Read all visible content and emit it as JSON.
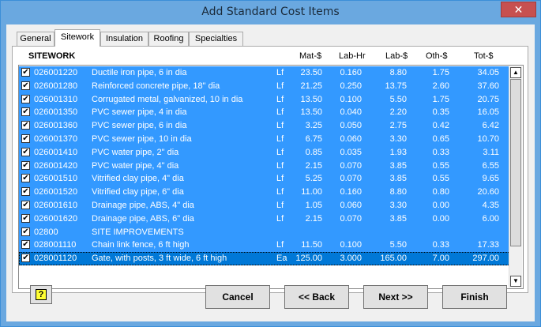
{
  "window": {
    "title": "Add Standard Cost Items",
    "close_glyph": "✕"
  },
  "tabs": [
    "General",
    "Sitework",
    "Insulation",
    "Roofing",
    "Specialties"
  ],
  "list_header": {
    "section": "SITEWORK",
    "mat": "Mat-$",
    "lab_hr": "Lab-Hr",
    "lab": "Lab-$",
    "oth": "Oth-$",
    "tot": "Tot-$"
  },
  "rows": [
    {
      "code": "026001220",
      "desc": "Ductile iron pipe, 6 in dia",
      "unit": "Lf",
      "mat": "23.50",
      "lab_hr": "0.160",
      "lab": "8.80",
      "oth": "1.75",
      "tot": "34.05",
      "checked": true
    },
    {
      "code": "026001280",
      "desc": "Reinforced concrete pipe, 18\" dia",
      "unit": "Lf",
      "mat": "21.25",
      "lab_hr": "0.250",
      "lab": "13.75",
      "oth": "2.60",
      "tot": "37.60",
      "checked": true
    },
    {
      "code": "026001310",
      "desc": "Corrugated metal, galvanized, 10 in dia",
      "unit": "Lf",
      "mat": "13.50",
      "lab_hr": "0.100",
      "lab": "5.50",
      "oth": "1.75",
      "tot": "20.75",
      "checked": true
    },
    {
      "code": "026001350",
      "desc": "PVC sewer pipe, 4 in dia",
      "unit": "Lf",
      "mat": "13.50",
      "lab_hr": "0.040",
      "lab": "2.20",
      "oth": "0.35",
      "tot": "16.05",
      "checked": true
    },
    {
      "code": "026001360",
      "desc": "PVC sewer pipe, 6 in dia",
      "unit": "Lf",
      "mat": "3.25",
      "lab_hr": "0.050",
      "lab": "2.75",
      "oth": "0.42",
      "tot": "6.42",
      "checked": true
    },
    {
      "code": "026001370",
      "desc": "PVC sewer pipe, 10 in dia",
      "unit": "Lf",
      "mat": "6.75",
      "lab_hr": "0.060",
      "lab": "3.30",
      "oth": "0.65",
      "tot": "10.70",
      "checked": true
    },
    {
      "code": "026001410",
      "desc": "PVC water pipe, 2\" dia",
      "unit": "Lf",
      "mat": "0.85",
      "lab_hr": "0.035",
      "lab": "1.93",
      "oth": "0.33",
      "tot": "3.11",
      "checked": true
    },
    {
      "code": "026001420",
      "desc": "PVC water pipe, 4\" dia",
      "unit": "Lf",
      "mat": "2.15",
      "lab_hr": "0.070",
      "lab": "3.85",
      "oth": "0.55",
      "tot": "6.55",
      "checked": true
    },
    {
      "code": "026001510",
      "desc": "Vitrified clay pipe, 4\" dia",
      "unit": "Lf",
      "mat": "5.25",
      "lab_hr": "0.070",
      "lab": "3.85",
      "oth": "0.55",
      "tot": "9.65",
      "checked": true
    },
    {
      "code": "026001520",
      "desc": "Vitrified clay pipe, 6\" dia",
      "unit": "Lf",
      "mat": "11.00",
      "lab_hr": "0.160",
      "lab": "8.80",
      "oth": "0.80",
      "tot": "20.60",
      "checked": true
    },
    {
      "code": "026001610",
      "desc": "Drainage pipe, ABS, 4\" dia",
      "unit": "Lf",
      "mat": "1.05",
      "lab_hr": "0.060",
      "lab": "3.30",
      "oth": "0.00",
      "tot": "4.35",
      "checked": true
    },
    {
      "code": "026001620",
      "desc": "Drainage pipe, ABS, 6\" dia",
      "unit": "Lf",
      "mat": "2.15",
      "lab_hr": "0.070",
      "lab": "3.85",
      "oth": "0.00",
      "tot": "6.00",
      "checked": true
    },
    {
      "code": "02800",
      "desc": "SITE IMPROVEMENTS",
      "unit": "",
      "mat": "",
      "lab_hr": "",
      "lab": "",
      "oth": "",
      "tot": "",
      "checked": true
    },
    {
      "code": "028001110",
      "desc": "Chain link fence, 6 ft high",
      "unit": "Lf",
      "mat": "11.50",
      "lab_hr": "0.100",
      "lab": "5.50",
      "oth": "0.33",
      "tot": "17.33",
      "checked": true
    },
    {
      "code": "028001120",
      "desc": "Gate, with posts, 3 ft wide, 6 ft high",
      "unit": "Ea",
      "mat": "125.00",
      "lab_hr": "3.000",
      "lab": "165.00",
      "oth": "7.00",
      "tot": "297.00",
      "checked": true,
      "selected": true
    }
  ],
  "buttons": {
    "cancel": "Cancel",
    "back": "<< Back",
    "next": "Next >>",
    "finish": "Finish"
  },
  "help_glyph": "?",
  "check_glyph": "✔",
  "colors": {
    "row_highlight": "#3399ff",
    "row_selected": "#0078d7",
    "title_bar": "#6aa8e0"
  }
}
